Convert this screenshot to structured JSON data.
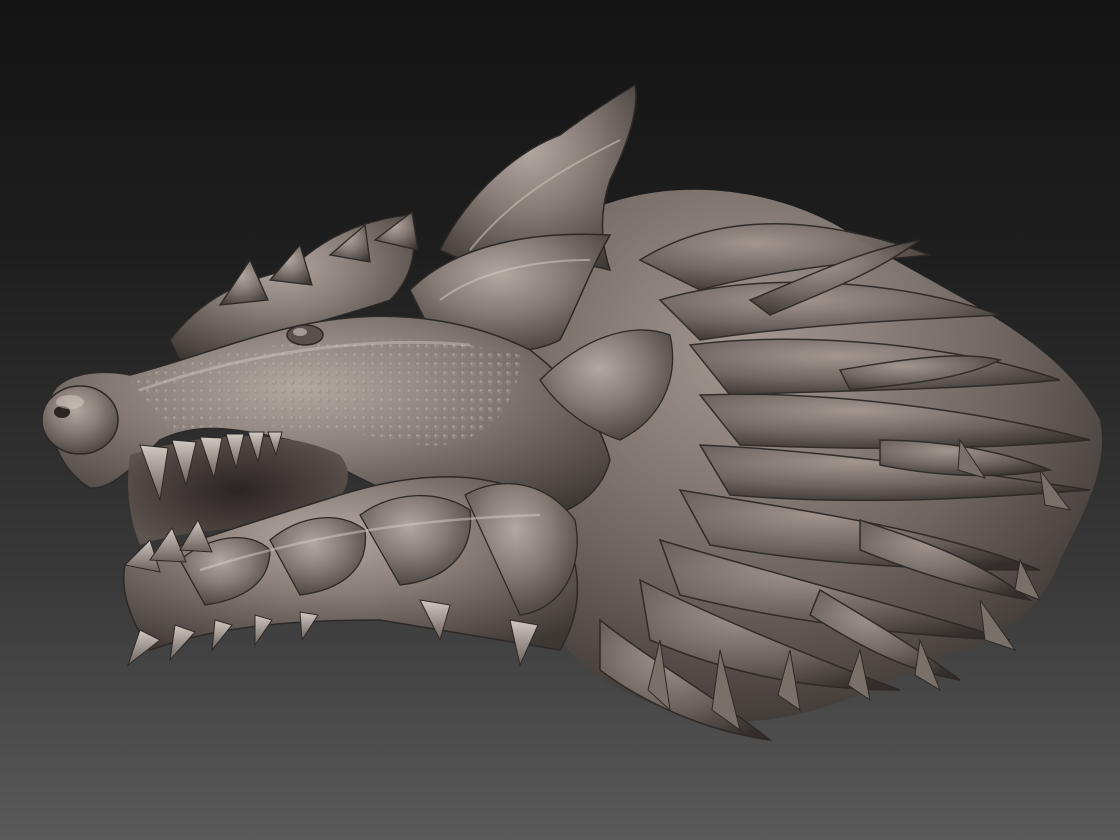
{
  "viewport": {
    "background_top": "#141414",
    "background_bottom": "#5a5a5a"
  },
  "model": {
    "subject": "dragon-wolf-head-sculpt",
    "material_color": "#8a7f79",
    "highlight_color": "#c9bfb8",
    "shadow_color": "#3e3835"
  }
}
